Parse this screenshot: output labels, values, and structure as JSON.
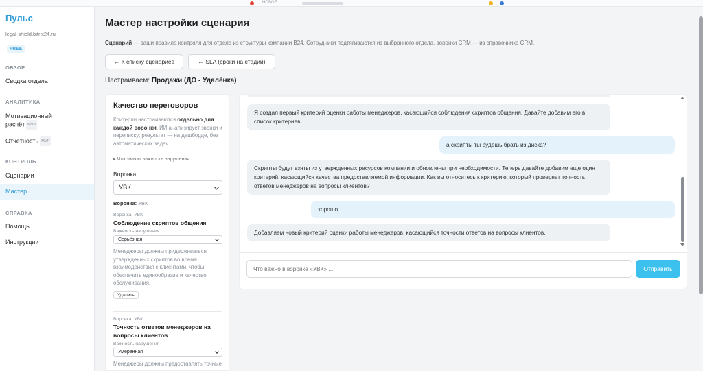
{
  "colors": {
    "accent": "#2e9bd6",
    "send_button": "#3cc1ef",
    "user_bubble": "#e3f2fb",
    "bot_bubble": "#eef1f4"
  },
  "browser": {
    "tab_label": "НОВОЕ"
  },
  "sidebar": {
    "brand": "Пульс",
    "domain": "legal-shield.bitrix24.ru",
    "plan": "FREE",
    "sections": [
      {
        "title": "ОБЗОР",
        "items": [
          {
            "label": "Сводка отдела",
            "badge": ""
          }
        ]
      },
      {
        "title": "АНАЛИТИКА",
        "items": [
          {
            "label_line1": "Мотивационный",
            "label_line2": "расчёт",
            "badge": "MVP"
          },
          {
            "label": "Отчётность",
            "badge": "MVP"
          }
        ]
      },
      {
        "title": "КОНТРОЛЬ",
        "items": [
          {
            "label": "Сценарии",
            "badge": ""
          },
          {
            "label": "Мастер",
            "badge": "",
            "active": true
          }
        ]
      },
      {
        "title": "СПРАВКА",
        "items": [
          {
            "label": "Помощь",
            "badge": ""
          },
          {
            "label": "Инструкции",
            "badge": ""
          }
        ]
      }
    ]
  },
  "header": {
    "title": "Мастер настройки сценария",
    "desc_bold": "Сценарий",
    "desc_rest": " — ваши правила контроля для отдела из структуры компании B24. Сотрудники подтягиваются из выбранного отдела, воронки CRM — из справочника CRM.",
    "back_button": "← К списку сценариев",
    "sla_button": "← SLA (сроки на стадии)",
    "tuning_label": "Настраиваем: ",
    "tuning_value": "Продажи (ДО - Удалёнка)"
  },
  "left_panel": {
    "title": "Качество переговоров",
    "intro_1": "Критерии настраиваются ",
    "intro_bold": "отдельно для каждой воронки",
    "intro_2": ". ИИ анализирует звонки и переписку; результат — на дашборде, без автоматических задач.",
    "toggle": "▸ Что значит важность нарушения",
    "funnel_label": "Воронка",
    "funnel_value": "УВК",
    "funnel_current_label": "Воронка: ",
    "funnel_current_value": "УВК",
    "criteria": [
      {
        "funnel": "Воронка: УВК",
        "title": "Соблюдение скриптов общения",
        "importance_label": "Важность нарушения",
        "importance_value": "Серьёзная",
        "description": "Менеджеры должны придерживаться утвержденных скриптов во время взаимодействия с клиентами, чтобы обеспечить единообразие и качество обслуживания.",
        "delete_label": "Удалить"
      },
      {
        "funnel": "Воронка: УВК",
        "title": "Точность ответов менеджеров на вопросы клиентов",
        "importance_label": "Важность нарушения",
        "importance_value": "Умеренная",
        "description": "Менеджеры должны предоставлять точные и актуальные ответы на"
      }
    ]
  },
  "chat": {
    "messages": [
      {
        "role": "bot",
        "text": "Я создал первый критерий оценки работы менеджеров, касающийся соблюдения скриптов общения. Давайте добавим его в список критериев"
      },
      {
        "role": "user",
        "text": "а скрипты ты будешь брать из диска?"
      },
      {
        "role": "bot",
        "text": "Скрипты будут взяты из утвержденных ресурсов компании и обновлены при необходимости. Теперь давайте добавим еще один критерий, касающийся качества предоставляемой информации. Как вы относитесь к критерию, который проверяет точность ответов менеджеров на вопросы клиентов?"
      },
      {
        "role": "user",
        "text": "хорошо"
      },
      {
        "role": "bot",
        "text": "Добавляем новый критерий оценки работы менеджеров, касающийся точности ответов на вопросы клиентов."
      }
    ],
    "input_placeholder": "Что важно в воронке «УВК» ...",
    "send_label": "Отправить"
  }
}
